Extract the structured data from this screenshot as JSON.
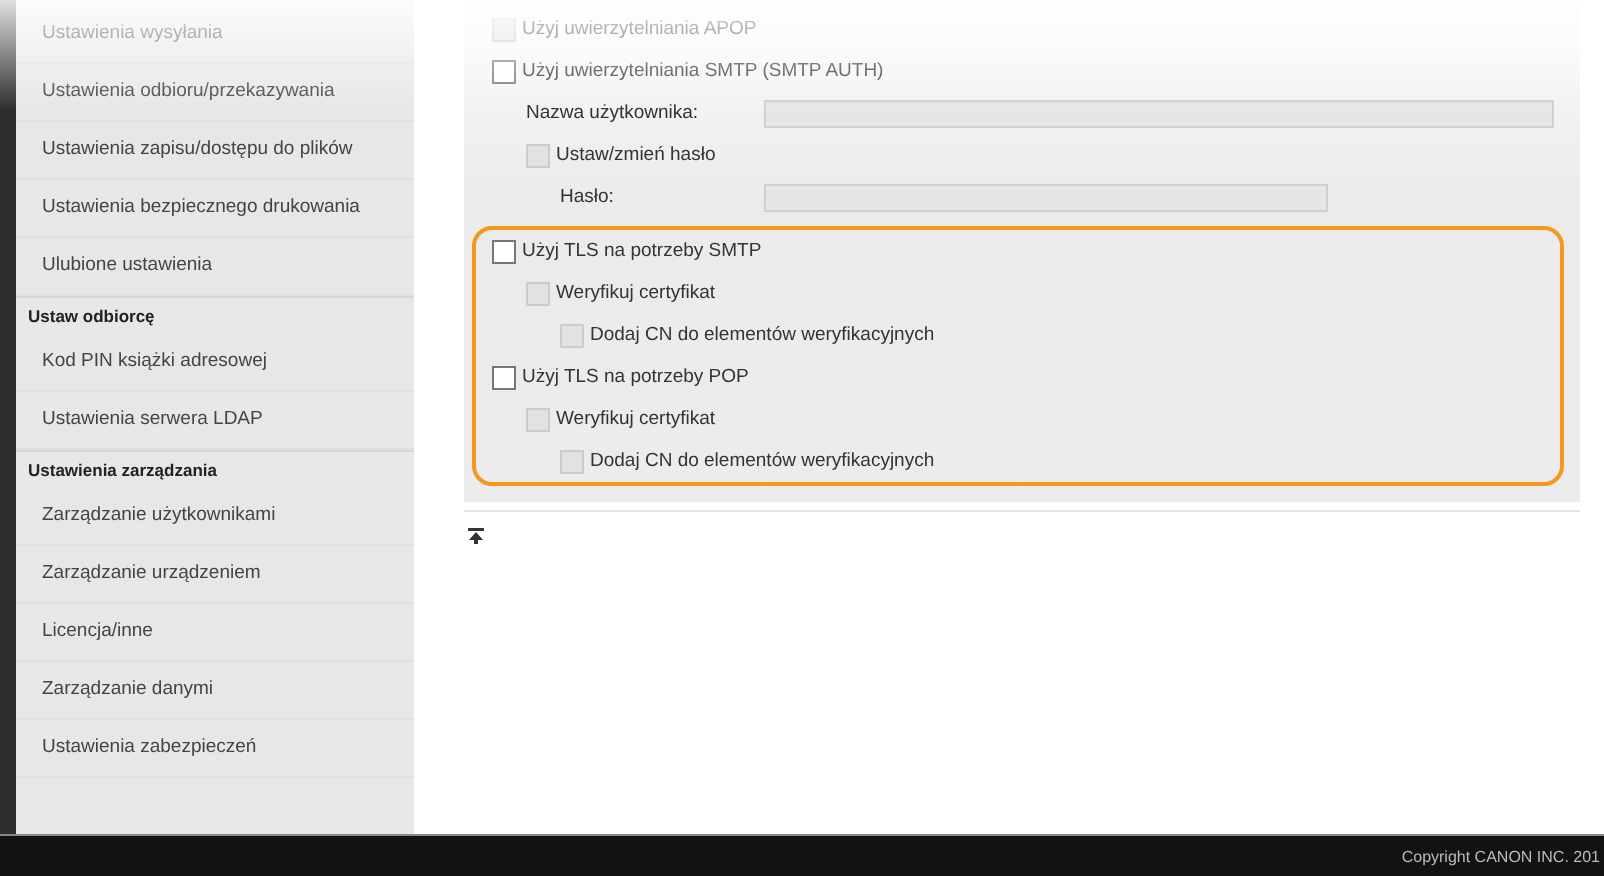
{
  "sidebar": {
    "items": [
      {
        "kind": "item",
        "label": "Ustawienia wysyłania"
      },
      {
        "kind": "item",
        "label": "Ustawienia odbioru/przekazywania"
      },
      {
        "kind": "item",
        "label": "Ustawienia zapisu/dostępu do plików"
      },
      {
        "kind": "item",
        "label": "Ustawienia bezpiecznego drukowania"
      },
      {
        "kind": "item",
        "label": "Ulubione ustawienia"
      },
      {
        "kind": "header",
        "label": "Ustaw odbiorcę"
      },
      {
        "kind": "item",
        "label": "Kod PIN książki adresowej"
      },
      {
        "kind": "item",
        "label": "Ustawienia serwera LDAP"
      },
      {
        "kind": "header",
        "label": "Ustawienia zarządzania"
      },
      {
        "kind": "item",
        "label": "Zarządzanie użytkownikami"
      },
      {
        "kind": "item",
        "label": "Zarządzanie urządzeniem"
      },
      {
        "kind": "item",
        "label": "Licencja/inne"
      },
      {
        "kind": "item",
        "label": "Zarządzanie danymi"
      },
      {
        "kind": "item",
        "label": "Ustawienia zabezpieczeń"
      }
    ]
  },
  "panel": {
    "rows": [
      {
        "kind": "checkbox",
        "label": "Użyj uwierzytelniania APOP",
        "checked": false,
        "disabled": true
      },
      {
        "kind": "checkbox",
        "label": "Użyj uwierzytelniania SMTP (SMTP AUTH)",
        "checked": false,
        "disabled": false,
        "children": [
          {
            "kind": "field",
            "label": "Nazwa użytkownika:",
            "wide": true,
            "disabled": true
          },
          {
            "kind": "checkbox",
            "label": "Ustaw/zmień hasło",
            "checked": false,
            "disabled": true,
            "children": [
              {
                "kind": "field",
                "label": "Hasło:",
                "wide": false,
                "disabled": true
              }
            ]
          }
        ]
      }
    ],
    "highlighted_group": {
      "highlighted": true,
      "rows": [
        {
          "kind": "checkbox",
          "label": "Użyj TLS na potrzeby SMTP",
          "checked": false,
          "disabled": false,
          "children": [
            {
              "kind": "checkbox",
              "label": "Weryfikuj certyfikat",
              "checked": false,
              "disabled": true,
              "children": [
                {
                  "kind": "checkbox",
                  "label": "Dodaj CN do elementów weryfikacyjnych",
                  "checked": false,
                  "disabled": true
                }
              ]
            }
          ]
        },
        {
          "kind": "checkbox",
          "label": "Użyj TLS na potrzeby POP",
          "checked": false,
          "disabled": false,
          "children": [
            {
              "kind": "checkbox",
              "label": "Weryfikuj certyfikat",
              "checked": false,
              "disabled": true,
              "children": [
                {
                  "kind": "checkbox",
                  "label": "Dodaj CN do elementów weryfikacyjnych",
                  "checked": false,
                  "disabled": true
                }
              ]
            }
          ]
        }
      ]
    }
  },
  "footer": {
    "copyright": "Copyright CANON INC. 201"
  }
}
